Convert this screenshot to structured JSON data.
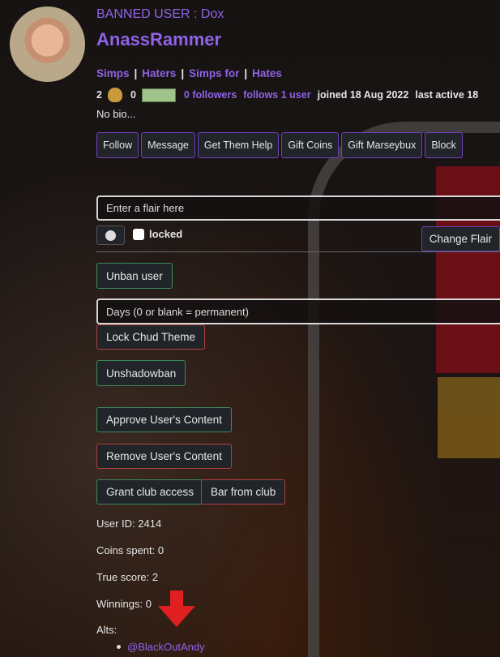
{
  "profile": {
    "banned_label": "BANNED USER : Dox",
    "username": "AnassRammer",
    "avatar_desc": "avatar",
    "relations": [
      "Simps",
      "Haters",
      "Simps for",
      "Hates"
    ],
    "coins": "2",
    "marseybux": "0",
    "followers": "0 followers",
    "follows": "follows 1 user",
    "joined": "joined 18 Aug 2022",
    "last_active": "last active 18",
    "bio": "No bio..."
  },
  "actions": [
    "Follow",
    "Message",
    "Get Them Help",
    "Gift Coins",
    "Gift Marseybux",
    "Block"
  ],
  "flair": {
    "placeholder": "Enter a flair here",
    "locked_label": "locked",
    "change_label": "Change Flair",
    "emoji_icon": "smiley-icon"
  },
  "admin": {
    "unban": "Unban user",
    "days_placeholder": "Days (0 or blank = permanent)",
    "lock_chud": "Lock Chud Theme",
    "unshadowban": "Unshadowban",
    "approve": "Approve User's Content",
    "remove": "Remove User's Content",
    "grant_club": "Grant club access",
    "bar_club": "Bar from club"
  },
  "stats": {
    "user_id": "User ID: 2414",
    "coins_spent": "Coins spent: 0",
    "true_score": "True score: 2",
    "winnings": "Winnings: 0",
    "alts_label": "Alts:",
    "alts": [
      "@BlackOutAndy"
    ]
  },
  "colors": {
    "accent": "#8f63e6",
    "approve": "#3c8a5a",
    "danger": "#b04040",
    "arrow": "#e02020"
  }
}
